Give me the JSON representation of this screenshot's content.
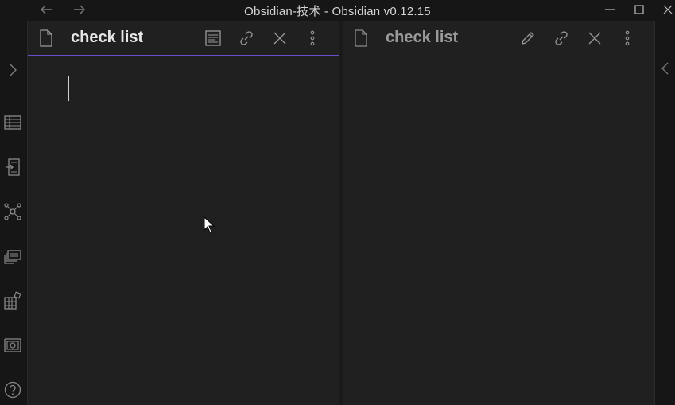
{
  "window": {
    "title": "Obsidian-技术 - Obsidian v0.12.15"
  },
  "left_pane": {
    "title": "check list",
    "mode": "editing"
  },
  "right_pane": {
    "title": "check list",
    "mode": "preview"
  },
  "icons": {
    "back": "arrow-left-icon",
    "forward": "arrow-right-icon",
    "minimize": "minimize-icon",
    "maximize": "maximize-icon",
    "close": "close-icon",
    "expand_left": "chevron-right-icon",
    "expand_right": "chevron-left-icon",
    "file": "file-icon",
    "reading_view": "book-icon",
    "edit": "pencil-icon",
    "link": "link-icon",
    "more": "more-vertical-icon",
    "ribbon": [
      "table-icon",
      "import-icon",
      "graph-icon",
      "cards-icon",
      "blocks-icon",
      "camera-icon",
      "help-icon"
    ]
  },
  "colors": {
    "accent": "#6b4fc9",
    "background": "#161616",
    "pane": "#202020"
  }
}
